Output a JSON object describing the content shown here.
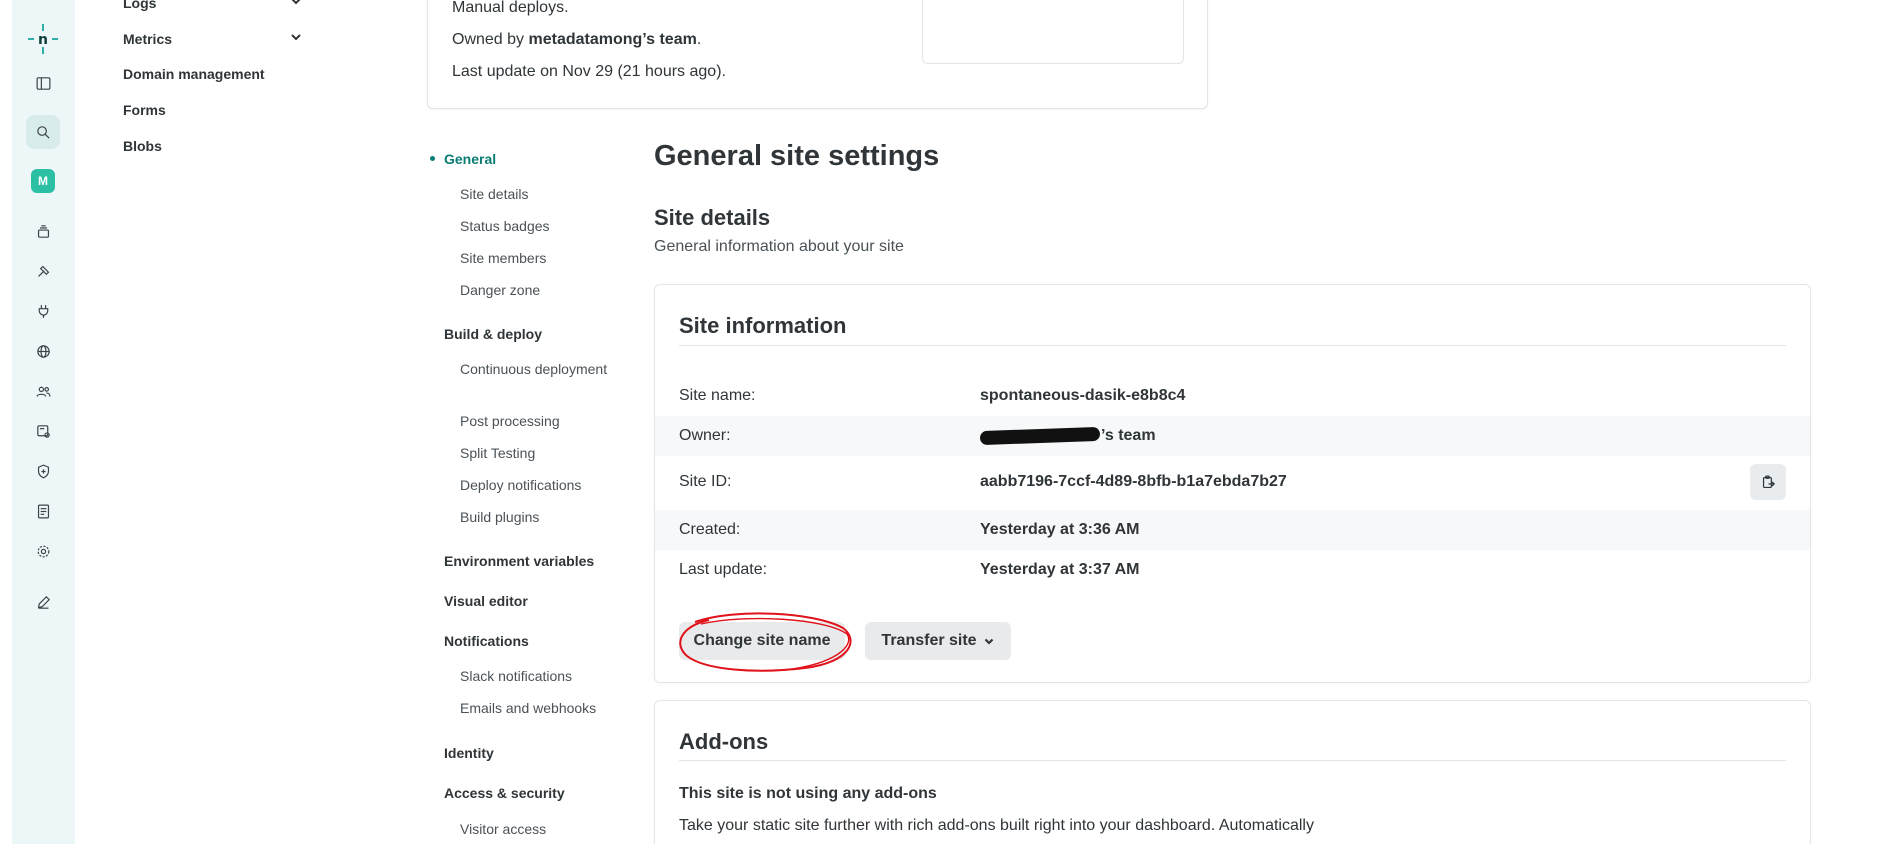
{
  "rail": {
    "avatar_letter": "M",
    "icons": [
      "netlify-logo-icon",
      "sidebar-toggle-icon",
      "search-icon",
      "team-avatar",
      "layers-icon",
      "hammer-icon",
      "plug-icon",
      "globe-icon",
      "users-icon",
      "monitor-settings-icon",
      "shield-icon",
      "ledger-icon",
      "gear-icon",
      "pencil-icon"
    ],
    "accent": "#2bbfa4"
  },
  "leftnav": {
    "logs": "Logs",
    "metrics": "Metrics",
    "domain_management": "Domain management",
    "forms": "Forms",
    "blobs": "Blobs"
  },
  "summary": {
    "deploys": "Manual deploys.",
    "owned_prefix": "Owned by ",
    "owned_team": "metadatamong’s team",
    "owned_suffix": ".",
    "last_update": "Last update on Nov 29 (21 hours ago)."
  },
  "sidenav": {
    "general": "General",
    "site_details": "Site details",
    "status_badges": "Status badges",
    "site_members": "Site members",
    "danger_zone": "Danger zone",
    "build_deploy": "Build & deploy",
    "continuous_deployment": "Continuous deployment",
    "post_processing": "Post processing",
    "split_testing": "Split Testing",
    "deploy_notifications": "Deploy notifications",
    "build_plugins": "Build plugins",
    "environment_variables": "Environment variables",
    "visual_editor": "Visual editor",
    "notifications": "Notifications",
    "slack_notifications": "Slack notifications",
    "emails_webhooks": "Emails and webhooks",
    "identity": "Identity",
    "access_security": "Access & security",
    "visitor_access": "Visitor access"
  },
  "main": {
    "title": "General site settings",
    "section_title": "Site details",
    "section_desc": "General information about your site"
  },
  "site_info": {
    "title": "Site information",
    "rows": [
      {
        "label": "Site name:",
        "value": "spontaneous-dasik-e8b8c4"
      },
      {
        "label": "Owner:",
        "value": "’s team"
      },
      {
        "label": "Site ID:",
        "value": "aabb7196-7ccf-4d89-8bfb-b1a7ebda7b27"
      },
      {
        "label": "Created:",
        "value": "Yesterday at 3:36 AM"
      },
      {
        "label": "Last update:",
        "value": "Yesterday at 3:37 AM"
      }
    ],
    "change_site_name": "Change site name",
    "transfer_site": "Transfer site"
  },
  "addons": {
    "title": "Add-ons",
    "empty_title": "This site is not using any add-ons",
    "empty_desc": "Take your static site further with rich add-ons built right into your dashboard. Automatically"
  },
  "colors": {
    "active": "#0a7c73",
    "annotation": "#e0121b"
  }
}
